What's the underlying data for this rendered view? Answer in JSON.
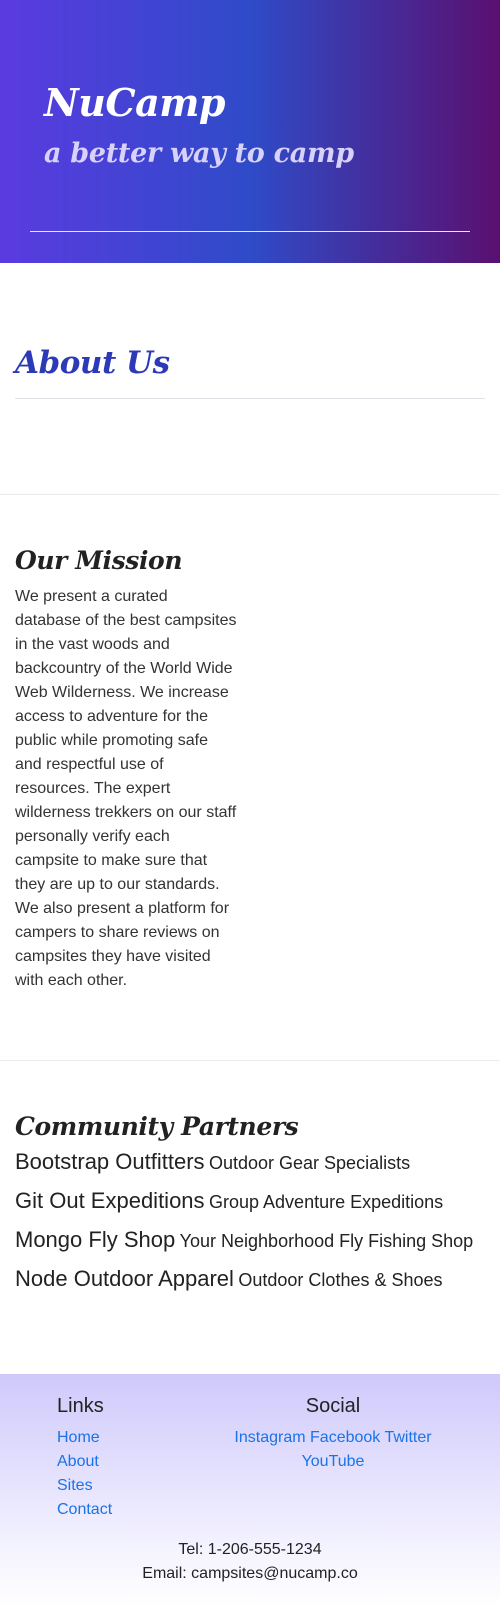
{
  "header": {
    "title": "NuCamp",
    "tagline": "a better way to camp"
  },
  "about": {
    "heading": "About Us"
  },
  "mission": {
    "heading": "Our Mission",
    "text": "We present a curated database of the best campsites in the vast woods and backcountry of the World Wide Web Wilderness. We increase access to adventure for the public while promoting safe and respectful use of resources. The expert wilderness trekkers on our staff personally verify each campsite to make sure that they are up to our standards. We also present a platform for campers to share reviews on campsites they have visited with each other."
  },
  "partners": {
    "heading": "Community Partners",
    "items": [
      {
        "name": "Bootstrap Outfitters",
        "description": "Outdoor Gear Specialists"
      },
      {
        "name": "Git Out Expeditions",
        "description": "Group Adventure Expeditions"
      },
      {
        "name": "Mongo Fly Shop",
        "description": "Your Neighborhood Fly Fishing Shop"
      },
      {
        "name": "Node Outdoor Apparel",
        "description": "Outdoor Clothes & Shoes"
      }
    ]
  },
  "footer": {
    "links_heading": "Links",
    "links": [
      "Home",
      "About",
      "Sites",
      "Contact"
    ],
    "social_heading": "Social",
    "social": [
      "Instagram",
      "Facebook",
      "Twitter",
      "YouTube"
    ],
    "tel": "Tel: 1-206-555-1234",
    "email": "Email: campsites@nucamp.co"
  },
  "colors": {
    "header_gradient_start": "#5a3be0",
    "header_gradient_mid": "#2f4bc8",
    "header_gradient_end": "#5a1070",
    "about_heading": "#2d3ab8",
    "link": "#1a73e8",
    "footer_top": "#cfc9fb"
  }
}
